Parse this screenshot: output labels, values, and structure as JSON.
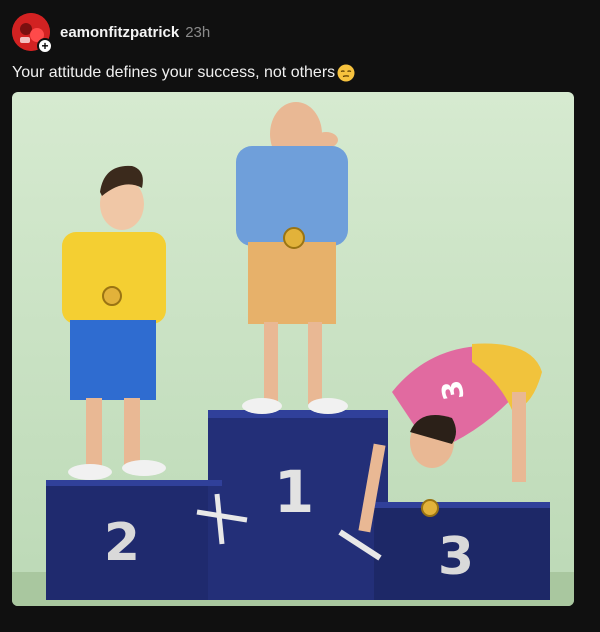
{
  "post": {
    "username": "eamonfitzpatrick",
    "timestamp": "23h",
    "caption": "Your attitude defines your success, not others",
    "emoji": "unamused-face-emoji",
    "image": {
      "description_icon": "podium-cartoon-image",
      "podium_labels": [
        "2",
        "1",
        "3"
      ],
      "shirt_number": "3"
    }
  },
  "icons": {
    "avatar": "avatar-image",
    "follow": "plus-icon"
  },
  "colors": {
    "background": "#101010",
    "username": "#f5f5f5",
    "timestamp": "#8a8a8a",
    "podium": "#1f2a6e",
    "sky": "#cfe4c7"
  }
}
